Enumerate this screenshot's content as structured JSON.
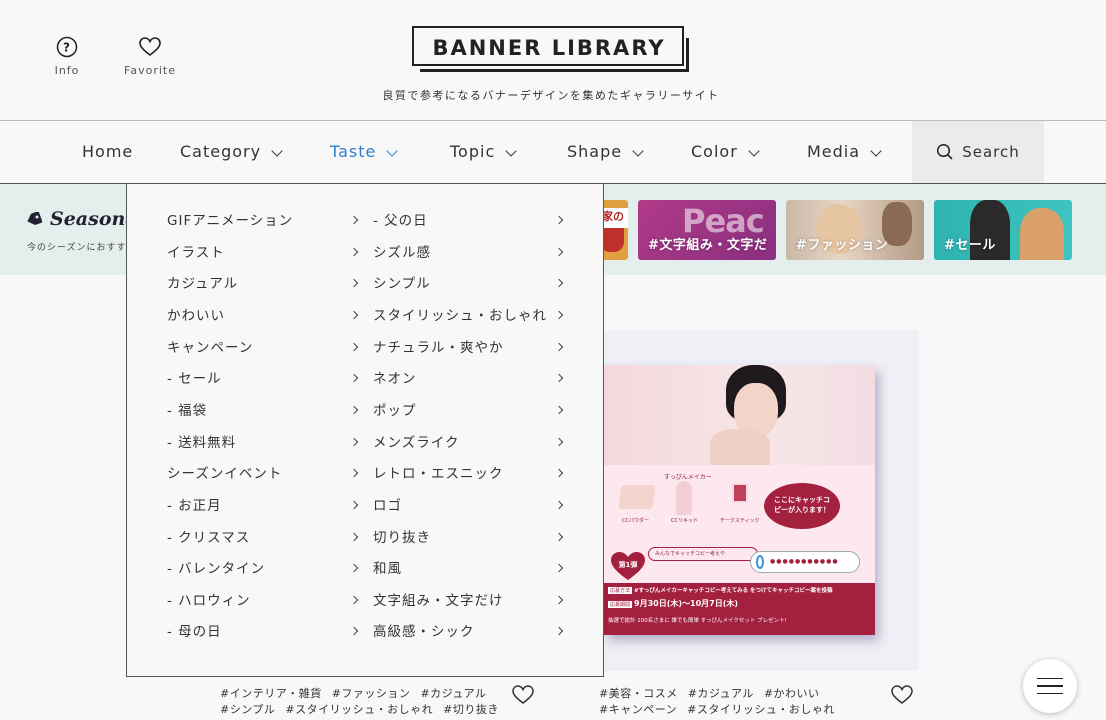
{
  "header": {
    "info_label": "Info",
    "favorite_label": "Favorite",
    "logo": "BANNER LIBRARY",
    "tagline": "良質で参考になるバナーデザインを集めたギャラリーサイト"
  },
  "nav": {
    "items": [
      {
        "label": "Home"
      },
      {
        "label": "Category"
      },
      {
        "label": "Taste"
      },
      {
        "label": "Topic"
      },
      {
        "label": "Shape"
      },
      {
        "label": "Color"
      },
      {
        "label": "Media"
      }
    ],
    "active": "Taste",
    "search_label": "Search"
  },
  "seasonal": {
    "title": "Seasonal",
    "subtitle": "今のシーズンにおすす",
    "thumbs": [
      {
        "label": "#文字組み・文字だ",
        "overlay": "Peac"
      },
      {
        "label": "#ファッション"
      },
      {
        "label": "#セール"
      }
    ],
    "partial_text": "家の"
  },
  "dropdown": {
    "col1": [
      "GIFアニメーション",
      "イラスト",
      "カジュアル",
      "かわいい",
      "キャンペーン",
      "- セール",
      "- 福袋",
      "- 送料無料",
      "シーズンイベント",
      "- お正月",
      "- クリスマス",
      "- バレンタイン",
      "- ハロウィン",
      "- 母の日"
    ],
    "col2": [
      "- 父の日",
      "シズル感",
      "シンプル",
      "スタイリッシュ・おしゃれ",
      "ナチュラル・爽やか",
      "ネオン",
      "ポップ",
      "メンズライク",
      "レトロ・エスニック",
      "ロゴ",
      "切り抜き",
      "和風",
      "文字組み・文字だけ",
      "高級感・シック"
    ]
  },
  "banner": {
    "brand": "すっぴんメイカー",
    "bubble": "ここにキャッチコピーが入ります！",
    "prompt": "みんなでキャッチコピー考えや",
    "dots": "●●●●●●●●●●●",
    "badge": "第1弾",
    "products": [
      "CCパウダー",
      "CCリキッド",
      "チークスティック"
    ],
    "row1_tag": "応募方法",
    "row1": "#すっぴんメイカーキャッチコピー考えてみる をつけてキャッチコピー案を投稿",
    "row2_tag": "応募期間",
    "row2": "9月30日(木)〜10月7日(木)",
    "row3": "抽選で総計 100名さまに 誰でも簡単 すっぴんメイクセット プレゼント!"
  },
  "cards": [
    {
      "tags_line1": [
        "#インテリア・雑貨",
        "#ファッション",
        "#カジュアル"
      ],
      "tags_line2": [
        "#シンプル",
        "#スタイリッシュ・おしゃれ",
        "#切り抜き"
      ]
    },
    {
      "tags_line1": [
        "#美容・コスメ",
        "#カジュアル",
        "#かわいい"
      ],
      "tags_line2": [
        "#キャンペーン",
        "#スタイリッシュ・おしゃれ"
      ]
    }
  ],
  "colors": {
    "accent": "#2a7fd0",
    "seasonal_bg": "#e4eeec",
    "banner_red": "#a3203f"
  }
}
